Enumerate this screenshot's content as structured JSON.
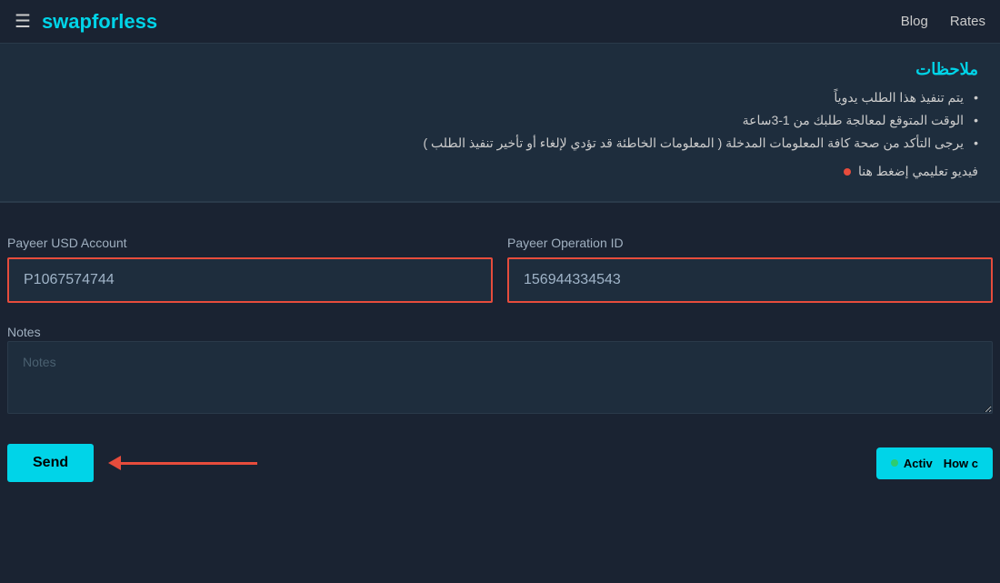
{
  "navbar": {
    "hamburger_icon": "☰",
    "brand": "swapforless",
    "links": [
      {
        "label": "Blog",
        "name": "blog-link"
      },
      {
        "label": "Rates",
        "name": "rates-link"
      }
    ]
  },
  "notes_box": {
    "title": "ملاحظات",
    "items": [
      "يتم تنفيذ هذا الطلب يدوياً",
      "الوقت المتوقع لمعالجة طلبك من 1-3ساعة",
      "يرجى التأكد من صحة كافة المعلومات المدخلة ( المعلومات الخاطئة قد تؤدي لإلغاء أو تأخير تنفيذ الطلب )"
    ],
    "tutorial_label": "فيديو تعليمي إضغط هنا"
  },
  "form": {
    "payeer_usd_label": "Payeer USD Account",
    "payeer_usd_placeholder": "P1067574744",
    "payeer_op_label": "Payeer Operation ID",
    "payeer_op_placeholder": "156944334543",
    "notes_label": "Notes",
    "notes_placeholder": "Notes"
  },
  "send_button": {
    "label": "Send"
  },
  "chat_button": {
    "label": "How c",
    "active_label": "Activ"
  }
}
